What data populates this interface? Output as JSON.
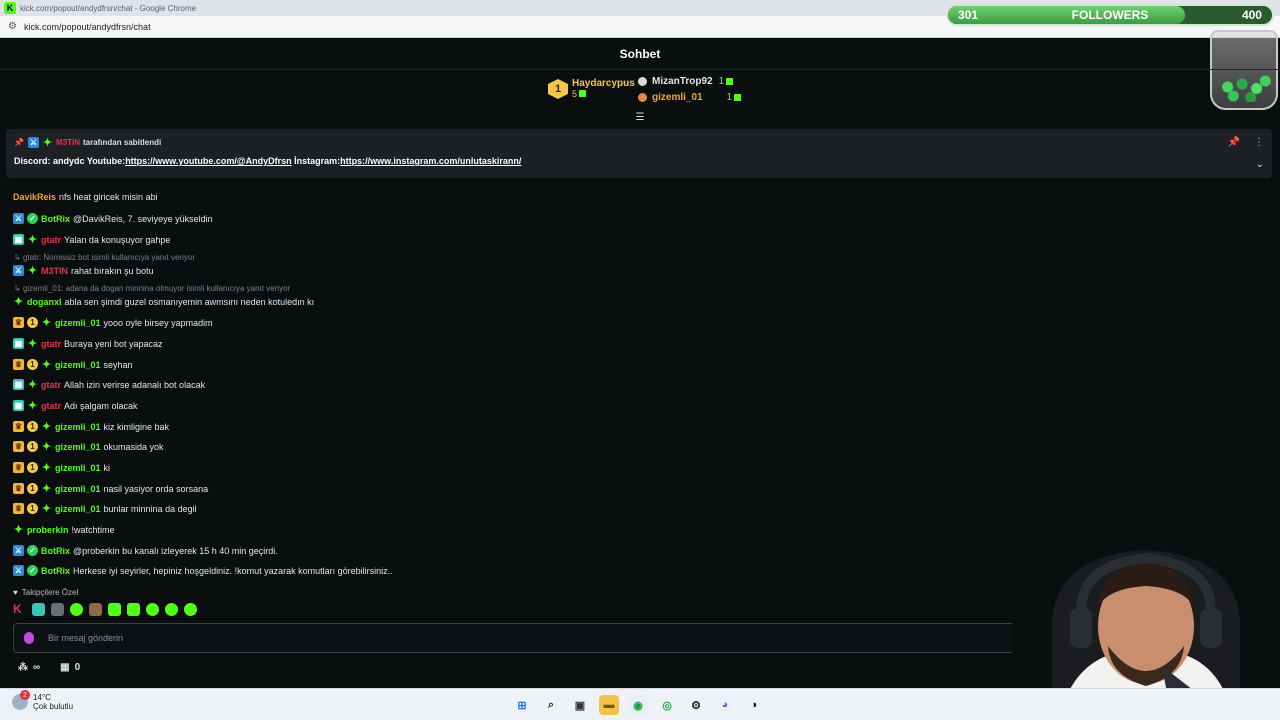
{
  "browser": {
    "title": "kick.com/popout/andydfrsn/chat - Google Chrome",
    "url": "kick.com/popout/andydfrsn/chat"
  },
  "followers_goal": {
    "current": "301",
    "label": "FOLLOWERS",
    "target": "400",
    "progress": 0.73
  },
  "chat_header": {
    "title": "Sohbet"
  },
  "leaderboard": {
    "top": {
      "rank": "1",
      "name": "Haydarcypus",
      "count": "5"
    },
    "others": [
      {
        "name": "MizanTrop92",
        "count": "1"
      },
      {
        "name": "gizemli_01",
        "count": "1"
      }
    ]
  },
  "pinned": {
    "pinned_by_user": "M3TIN",
    "pinned_by_suffix": "tarafından sabitlendi",
    "prefix": "Discord: andydc Youtube:",
    "youtube_link": "https://www.youtube.com/@AndyDfrsn",
    "mid": " İnstagram:",
    "instagram_link": "https://www.instagram.com/unlutaskirann/"
  },
  "messages": [
    {
      "user": "DavikReis",
      "text": "nfs heat giricek misin abi"
    },
    {
      "user": "BotRix",
      "text": "@DavikReis, 7. seviyeye yükseldin"
    },
    {
      "user": "gtatr",
      "text": "Yalan da konuşuyor gahpe"
    },
    {
      "reply": "gtatr: Nomissiz bot isimli kullanıcıya yanıt veriyor"
    },
    {
      "user": "M3TIN",
      "text": "rahat bırakın şu botu"
    },
    {
      "reply": "gizemli_01: adana da dogan minnina olmuyor isimli kullanıcıya yanıt veriyor"
    },
    {
      "user": "doganxl",
      "text": "abla sen şimdi guzel osmanıyemin awmsını neden kotuledın kı"
    },
    {
      "user": "gizemli_01",
      "text": "yooo oyle birsey yapmadim"
    },
    {
      "user": "gtatr",
      "text": "Buraya yeni bot yapacaz"
    },
    {
      "user": "gizemli_01",
      "text": "seyhan"
    },
    {
      "user": "gtatr",
      "text": "Allah izin verirse adanalı bot olacak"
    },
    {
      "user": "gtatr",
      "text": "Adı şalgam olacak"
    },
    {
      "user": "gizemli_01",
      "text": "kiz kimligine bak"
    },
    {
      "user": "gizemli_01",
      "text": "okumasida yok"
    },
    {
      "user": "gizemli_01",
      "text": "ki"
    },
    {
      "user": "gizemli_01",
      "text": "nasil yasiyor orda sorsana"
    },
    {
      "user": "gizemli_01",
      "text": "bunlar minnina da degil"
    },
    {
      "user": "proberkin",
      "text": "!watchtime"
    },
    {
      "user": "BotRix",
      "text": "@proberkin bu kanalı izleyerek 15 h 40 min geçirdi."
    },
    {
      "user": "BotRix",
      "text": "Herkese iyi seyirler, hepiniz hoşgeldiniz. !komut yazarak komutları görebilirsiniz.."
    }
  ],
  "followers_only": "Takipçilere Özel",
  "input": {
    "placeholder": "Bir mesaj gönderin"
  },
  "footer": {
    "infinity": "∞",
    "count": "0"
  },
  "colors": {
    "accent": "#53fc18",
    "mod_red": "#e0354a",
    "username_orange": "#f5a623",
    "username_green": "#53fc18"
  },
  "taskbar": {
    "weather_temp": "14°C",
    "weather_desc": "Çok bulutlu",
    "weather_badge": "2"
  }
}
